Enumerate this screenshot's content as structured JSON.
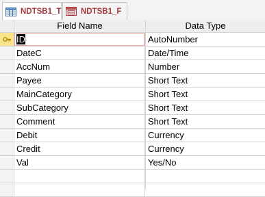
{
  "tabs": [
    {
      "label": "NDTSB1_T",
      "icon": "table-icon",
      "active": true,
      "close": "×"
    },
    {
      "label": "NDTSB1_F",
      "icon": "form-icon",
      "active": false,
      "close": ""
    }
  ],
  "grid": {
    "headers": {
      "name": "Field Name",
      "type": "Data Type"
    },
    "current_row": 0,
    "current_selection": "ID",
    "rows": [
      {
        "name": "ID",
        "type": "AutoNumber",
        "key": true
      },
      {
        "name": "DateC",
        "type": "Date/Time"
      },
      {
        "name": "AccNum",
        "type": "Number"
      },
      {
        "name": "Payee",
        "type": "Short Text"
      },
      {
        "name": "MainCategory",
        "type": "Short Text"
      },
      {
        "name": "SubCategory",
        "type": "Short Text"
      },
      {
        "name": "Comment",
        "type": "Short Text"
      },
      {
        "name": "Debit",
        "type": "Currency"
      },
      {
        "name": "Credit",
        "type": "Currency"
      },
      {
        "name": "Val",
        "type": "Yes/No"
      },
      {
        "name": "",
        "type": ""
      },
      {
        "name": "",
        "type": ""
      }
    ]
  },
  "colors": {
    "tab_text": "#a4373a",
    "selector_current": "#f7e48a",
    "grid_line": "#d4d4d4"
  }
}
